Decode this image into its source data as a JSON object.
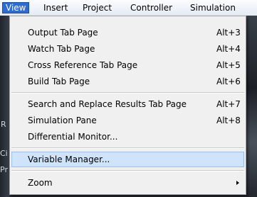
{
  "menubar": {
    "items": [
      "View",
      "Insert",
      "Project",
      "Controller",
      "Simulation"
    ],
    "open_item": "View"
  },
  "background": {
    "fragments": [
      "R",
      "Ci",
      "Pr"
    ]
  },
  "view_menu": {
    "items": [
      {
        "label": "Output Tab Page",
        "shortcut": "Alt+3"
      },
      {
        "label": "Watch Tab Page",
        "shortcut": "Alt+4"
      },
      {
        "label": "Cross Reference Tab Page",
        "shortcut": "Alt+5"
      },
      {
        "label": "Build Tab Page",
        "shortcut": "Alt+6"
      },
      {
        "label": "Search and Replace Results Tab Page",
        "shortcut": "Alt+7"
      },
      {
        "label": "Simulation Pane",
        "shortcut": "Alt+8"
      },
      {
        "label": "Differential Monitor...",
        "shortcut": ""
      },
      {
        "label": "Variable Manager...",
        "shortcut": ""
      },
      {
        "label": "Zoom",
        "shortcut": ""
      }
    ],
    "highlighted_item": "Variable Manager...",
    "submenu_item": "Zoom"
  },
  "colors": {
    "menubar_active": "#2e6bd3",
    "menu_background": "#f0f0f0",
    "highlight": "#cfe3fb"
  }
}
